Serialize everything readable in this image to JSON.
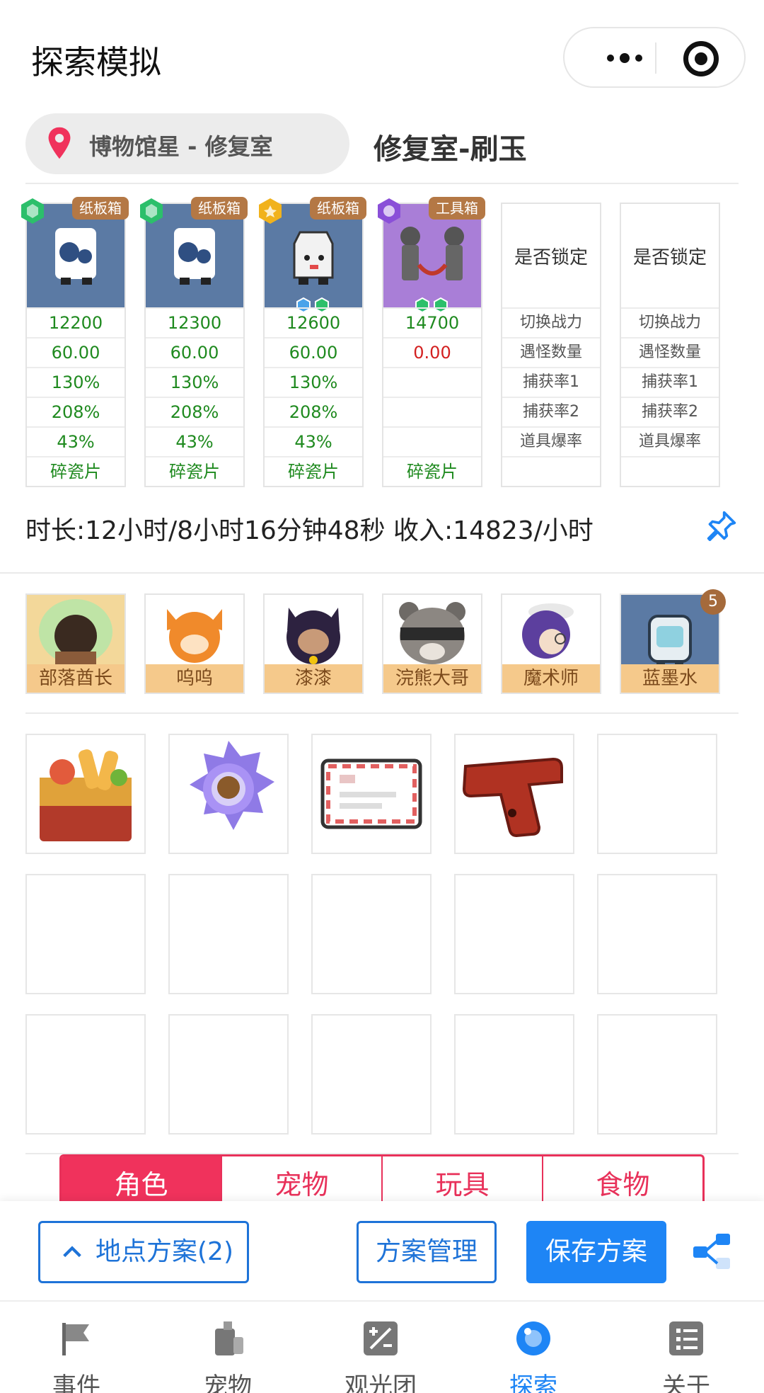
{
  "app": {
    "title": "探索模拟"
  },
  "location": {
    "path": "博物馆星 - 修复室",
    "title": "修复室-刷玉"
  },
  "equipment": [
    {
      "tag": "纸板箱",
      "power": "12200",
      "count": "60.00",
      "rate1": "130%",
      "rate2": "208%",
      "drop": "43%",
      "item": "碎瓷片",
      "badge_color": "#2cbf6b"
    },
    {
      "tag": "纸板箱",
      "power": "12300",
      "count": "60.00",
      "rate1": "130%",
      "rate2": "208%",
      "drop": "43%",
      "item": "碎瓷片",
      "badge_color": "#2cbf6b"
    },
    {
      "tag": "纸板箱",
      "power": "12600",
      "count": "60.00",
      "rate1": "130%",
      "rate2": "208%",
      "drop": "43%",
      "item": "碎瓷片",
      "badge_color": "#f1b21c"
    },
    {
      "tag": "工具箱",
      "power": "14700",
      "count": "0.00",
      "rate1": "",
      "rate2": "",
      "drop": "",
      "item": "碎瓷片",
      "badge_color": "#8a4fd8"
    }
  ],
  "lock_columns": [
    {
      "header": "是否锁定",
      "rows": [
        "切换战力",
        "遇怪数量",
        "捕获率1",
        "捕获率2",
        "道具爆率"
      ]
    },
    {
      "header": "是否锁定",
      "rows": [
        "切换战力",
        "遇怪数量",
        "捕获率1",
        "捕获率2",
        "道具爆率"
      ]
    }
  ],
  "duration_text": "时长:12小时/8小时16分钟48秒 收入:14823/小时",
  "pets": [
    {
      "name": "部落酋长",
      "bg": "#f3d89a"
    },
    {
      "name": "呜呜",
      "bg": "#fde2c2"
    },
    {
      "name": "漆漆",
      "bg": "#ead5f2"
    },
    {
      "name": "浣熊大哥",
      "bg": "#e8e2dc"
    },
    {
      "name": "魔术师",
      "bg": "#ece6f4"
    },
    {
      "name": "蓝墨水",
      "bg": "#5b7aa4"
    }
  ],
  "pet_count_badge": "5",
  "category_tabs": [
    {
      "label": "角色",
      "active": true
    },
    {
      "label": "宠物",
      "active": false
    },
    {
      "label": "玩具",
      "active": false
    },
    {
      "label": "食物",
      "active": false
    }
  ],
  "actions": {
    "plan_label": "地点方案(2)",
    "manage_label": "方案管理",
    "save_label": "保存方案"
  },
  "nav": [
    {
      "label": "事件",
      "icon": "flag-icon"
    },
    {
      "label": "宠物",
      "icon": "pet-icon"
    },
    {
      "label": "观光团",
      "icon": "calculator-icon"
    },
    {
      "label": "探索",
      "icon": "explore-icon",
      "active": true
    },
    {
      "label": "关于",
      "icon": "list-icon"
    }
  ],
  "colors": {
    "accent": "#1e85f5",
    "tab_accent": "#f0325c",
    "value_green": "#1f8a1f",
    "value_red": "#d32020"
  }
}
